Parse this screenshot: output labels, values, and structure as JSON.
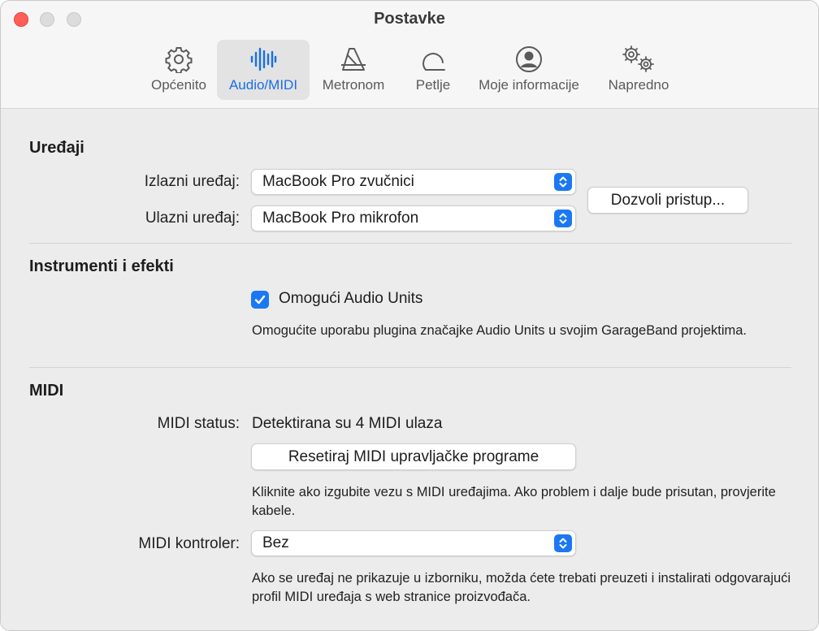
{
  "window": {
    "title": "Postavke"
  },
  "tabs": [
    {
      "id": "general",
      "label": "Općenito",
      "icon": "gear-icon"
    },
    {
      "id": "audio-midi",
      "label": "Audio/MIDI",
      "icon": "waveform-icon",
      "active": true
    },
    {
      "id": "metronome",
      "label": "Metronom",
      "icon": "metronome-icon"
    },
    {
      "id": "loops",
      "label": "Petlje",
      "icon": "loop-icon"
    },
    {
      "id": "my-info",
      "label": "Moje informacije",
      "icon": "person-circle-icon"
    },
    {
      "id": "advanced",
      "label": "Napredno",
      "icon": "gears-icon"
    }
  ],
  "devices": {
    "section_title": "Uređaji",
    "output_label": "Izlazni uređaj:",
    "output_value": "MacBook Pro zvučnici",
    "input_label": "Ulazni uređaj:",
    "input_value": "MacBook Pro mikrofon",
    "allow_access_button": "Dozvoli pristup..."
  },
  "instruments": {
    "section_title": "Instrumenti i efekti",
    "audio_units_label": "Omogući Audio Units",
    "audio_units_checked": true,
    "audio_units_desc": "Omogućite uporabu plugina značajke Audio Units u svojim GarageBand projektima."
  },
  "midi": {
    "section_title": "MIDI",
    "status_label": "MIDI status:",
    "status_value": "Detektirana su 4 MIDI ulaza",
    "reset_button": "Resetiraj MIDI upravljačke programe",
    "reset_desc": "Kliknite ako izgubite vezu s MIDI uređajima. Ako problem i dalje bude prisutan, provjerite kabele.",
    "controller_label": "MIDI kontroler:",
    "controller_value": "Bez",
    "controller_desc": "Ako se uređaj ne prikazuje u izborniku, možda ćete trebati preuzeti i instalirati odgovarajući profil MIDI uređaja s web stranice proizvođača."
  },
  "colors": {
    "accent": "#1b78f2",
    "active_tab_text": "#1a6ee6",
    "close_button": "#ff5f57"
  }
}
